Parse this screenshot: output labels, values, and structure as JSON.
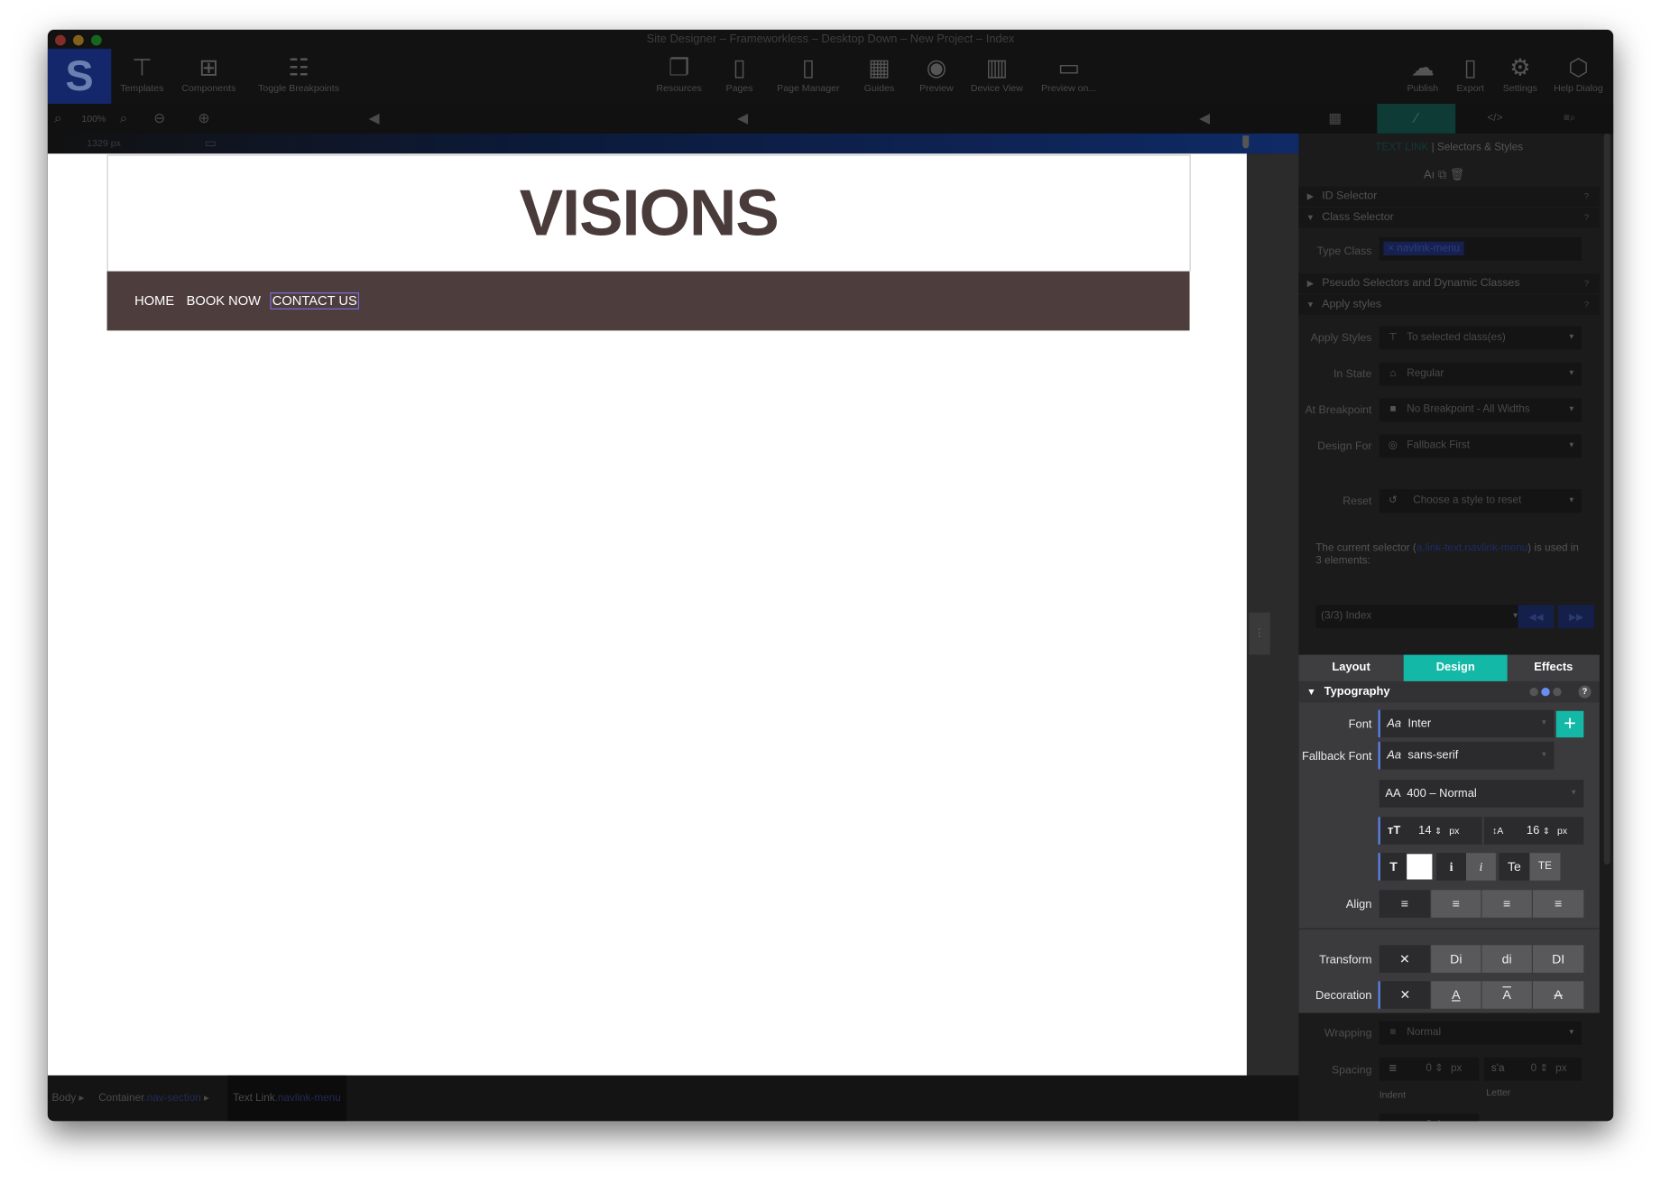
{
  "window": {
    "title": "Site Designer – Frameworkless – Desktop Down – New Project – Index"
  },
  "toolbar": {
    "left": [
      {
        "label": "Templates",
        "icon": "paint-roller-icon"
      },
      {
        "label": "Components",
        "icon": "puzzle-icon"
      },
      {
        "label": "Toggle Breakpoints",
        "icon": "toggle-icon"
      }
    ],
    "center": [
      {
        "label": "Resources",
        "icon": "folders-icon"
      },
      {
        "label": "Pages",
        "icon": "pages-icon"
      },
      {
        "label": "Page Manager",
        "icon": "page-manager-icon"
      },
      {
        "label": "Guides",
        "icon": "guides-icon"
      },
      {
        "label": "Preview",
        "icon": "eye-icon"
      },
      {
        "label": "Device View",
        "icon": "devices-icon"
      },
      {
        "label": "Preview on...",
        "icon": "monitor-icon"
      }
    ],
    "right": [
      {
        "label": "Publish",
        "icon": "cloud-upload-icon"
      },
      {
        "label": "Export",
        "icon": "export-icon"
      },
      {
        "label": "Settings",
        "icon": "gear-icon"
      },
      {
        "label": "Help Dialog",
        "icon": "help-icon"
      }
    ]
  },
  "zoom": {
    "level": "100%"
  },
  "ruler": {
    "width": "1329 px"
  },
  "page": {
    "heading": "VISIONS",
    "nav": [
      "HOME",
      "BOOK NOW",
      "CONTACT US"
    ],
    "heading_color": "#4a3b3b",
    "nav_bg": "#4e3d3d"
  },
  "breadcrumb": [
    {
      "label": "Body",
      "cls": ""
    },
    {
      "label": "Container",
      "cls": ".nav-section"
    },
    {
      "label": "Text Link",
      "cls": ".navlink-menu"
    }
  ],
  "panel": {
    "header_type": "TEXT LINK",
    "header_title": "| Selectors & Styles",
    "sections": {
      "id": "ID Selector",
      "class": "Class Selector",
      "pseudo": "Pseudo Selectors and Dynamic Classes",
      "apply": "Apply styles"
    },
    "type_class_label": "Type Class",
    "type_class_tag": "× navlink-menu",
    "apply_rows": [
      {
        "label": "Apply Styles",
        "value": "To selected class(es)"
      },
      {
        "label": "In State",
        "value": "Regular"
      },
      {
        "label": "At Breakpoint",
        "value": "No Breakpoint - All Widths"
      },
      {
        "label": "Design For",
        "value": "Fallback First"
      }
    ],
    "reset_label": "Reset",
    "reset_value": "Choose a style to reset",
    "selector_text_a": "The current selector (",
    "selector_name": "a.link-text.navlink-menu",
    "selector_text_b": ") is used in 3 elements:",
    "selector_page": "(3/3) Index",
    "tabs": [
      "Layout",
      "Design",
      "Effects"
    ],
    "active_tab": "Design",
    "typography": "Typography",
    "font_label": "Font",
    "font": "Inter",
    "fallback_label": "Fallback Font",
    "fallback": "sans-serif",
    "weight": "400 – Normal",
    "size": "14",
    "size_unit": "px",
    "line_height": "16",
    "lh_unit": "px",
    "text_color": "#ffffff",
    "align_label": "Align",
    "transform_label": "Transform",
    "transform_opts": [
      "Di",
      "di",
      "DI"
    ],
    "decoration_label": "Decoration",
    "wrapping_label": "Wrapping",
    "wrapping": "Normal",
    "spacing_label": "Spacing",
    "indent": "0",
    "letter": "0",
    "word": "0",
    "unit": "px",
    "indent_label": "Indent",
    "letter_label": "Letter",
    "accent": "#14b8a6"
  }
}
